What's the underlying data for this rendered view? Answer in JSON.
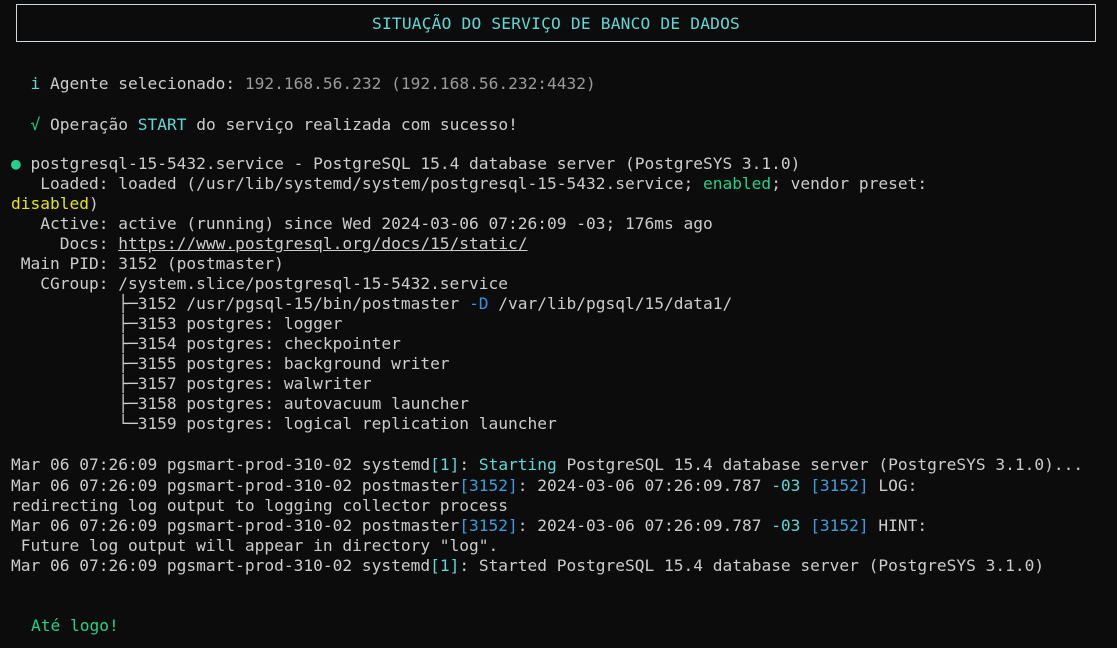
{
  "banner": {
    "title": "SITUAÇÃO DO SERVIÇO DE BANCO DE DADOS"
  },
  "info": {
    "icon": "i",
    "label": "Agente selecionado:",
    "agent": "192.168.56.232",
    "agent_addr": "(192.168.56.232:4432)"
  },
  "success": {
    "icon": "√",
    "prefix": "Operação",
    "action": "START",
    "suffix": "do serviço realizada com sucesso!"
  },
  "status": {
    "bullet": "●",
    "unit_line": "postgresql-15-5432.service - PostgreSQL 15.4 database server (PostgreSYS 3.1.0)",
    "loaded_a": "   Loaded: loaded (/usr/lib/systemd/system/postgresql-15-5432.service; ",
    "loaded_enabled": "enabled",
    "loaded_b": "; vendor preset:",
    "loaded_disabled": "disabled",
    "loaded_close": ")",
    "active": "   Active: active (running) since Wed 2024-03-06 07:26:09 -03; 176ms ago",
    "docs_label": "     Docs: ",
    "docs_url": "https://www.postgresql.org/docs/15/static/",
    "main_pid": " Main PID: 3152 (postmaster)",
    "cgroup": "   CGroup: /system.slice/postgresql-15-5432.service",
    "tree_first_a": "           ├─3152 /usr/pgsql-15/bin/postmaster ",
    "tree_first_flag": "-D",
    "tree_first_b": " /var/lib/pgsql/15/data1/",
    "tree": [
      "           ├─3153 postgres: logger",
      "           ├─3154 postgres: checkpointer",
      "           ├─3155 postgres: background writer",
      "           ├─3157 postgres: walwriter",
      "           ├─3158 postgres: autovacuum launcher",
      "           └─3159 postgres: logical replication launcher"
    ]
  },
  "journal": {
    "l1_a": "Mar 06 07:26:09 pgsmart-prod-310-02 systemd",
    "l1_pid": "[1]",
    "l1_colon": ": ",
    "l1_word": "Starting",
    "l1_b": " PostgreSQL 15.4 database server (PostgreSYS 3.1.0)...",
    "l2_a": "Mar 06 07:26:09 pgsmart-prod-310-02 postmaster",
    "l2_pid": "[3152]",
    "l2_b": ": 2024-03-06 07:26:09.787 ",
    "l2_tz": "-03",
    "l2_sp": " ",
    "l2_pid2": "[3152]",
    "l2_c": " LOG:",
    "l3": "redirecting log output to logging collector process",
    "l4_a": "Mar 06 07:26:09 pgsmart-prod-310-02 postmaster",
    "l4_pid": "[3152]",
    "l4_b": ": 2024-03-06 07:26:09.787 ",
    "l4_tz": "-03",
    "l4_sp": " ",
    "l4_pid2": "[3152]",
    "l4_c": " HINT:",
    "l5": " Future log output will appear in directory \"log\".",
    "l6_a": "Mar 06 07:26:09 pgsmart-prod-310-02 systemd",
    "l6_pid": "[1]",
    "l6_b": ": Started PostgreSQL 15.4 database server (PostgreSYS 3.1.0)"
  },
  "footer": {
    "bye": "Até logo!"
  },
  "colors": {
    "background": "#0c0c0c",
    "text": "#cccccc",
    "cyan": "#61d6d6",
    "green": "#23d18b",
    "yellow": "#e5e510",
    "blue": "#3b8eea"
  }
}
